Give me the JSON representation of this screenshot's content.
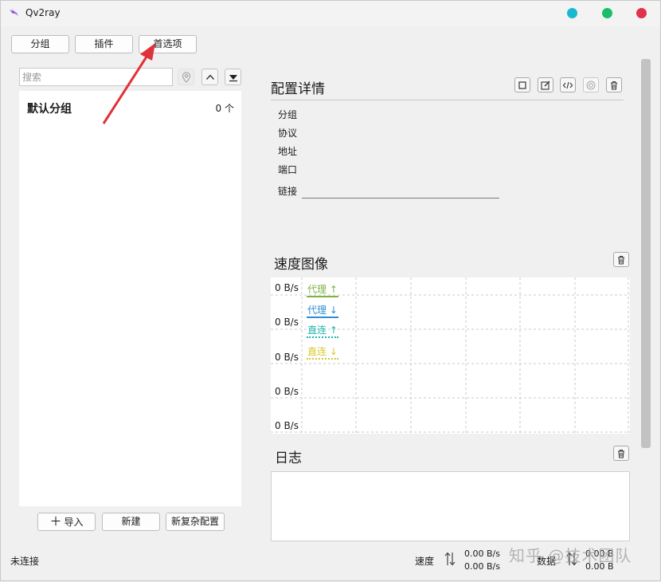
{
  "window": {
    "title": "Qv2ray"
  },
  "toolbar": {
    "group_label": "分组",
    "plugins_label": "插件",
    "preferences_label": "首选项"
  },
  "search": {
    "placeholder": "搜索"
  },
  "groups": [
    {
      "name": "默认分组",
      "count": "0 个"
    }
  ],
  "left_actions": {
    "import_label": "导入",
    "new_label": "新建",
    "new_complex_label": "新复杂配置"
  },
  "details": {
    "title": "配置详情",
    "fields": {
      "group": "分组",
      "protocol": "协议",
      "address": "地址",
      "port": "端口",
      "link": "链接"
    }
  },
  "speed_chart": {
    "title": "速度图像",
    "y_ticks": [
      "0 B/s",
      "0 B/s",
      "0 B/s",
      "0 B/s",
      "0 B/s"
    ],
    "legend": [
      {
        "label": "代理 ↑",
        "color": "#7cb342"
      },
      {
        "label": "代理 ↓",
        "color": "#2a8fd6"
      },
      {
        "label": "直连 ↑",
        "color": "#1fb5b0"
      },
      {
        "label": "直连 ↓",
        "color": "#d8c92a"
      }
    ]
  },
  "chart_data": {
    "type": "line",
    "title": "速度图像",
    "y_tick_labels": [
      "0 B/s",
      "0 B/s",
      "0 B/s",
      "0 B/s",
      "0 B/s"
    ],
    "series": [
      {
        "name": "代理 ↑",
        "values": []
      },
      {
        "name": "代理 ↓",
        "values": []
      },
      {
        "name": "直连 ↑",
        "values": []
      },
      {
        "name": "直连 ↓",
        "values": []
      }
    ],
    "grid": true,
    "legend_position": "top-left"
  },
  "log": {
    "title": "日志"
  },
  "status": {
    "connection": "未连接",
    "speed_label": "速度",
    "upload_speed": "0.00 B/s",
    "download_speed": "0.00 B/s",
    "data_label": "数据",
    "upload_data": "0.00 B",
    "download_data": "0.00 B"
  },
  "watermark": "知乎 @技术团队"
}
